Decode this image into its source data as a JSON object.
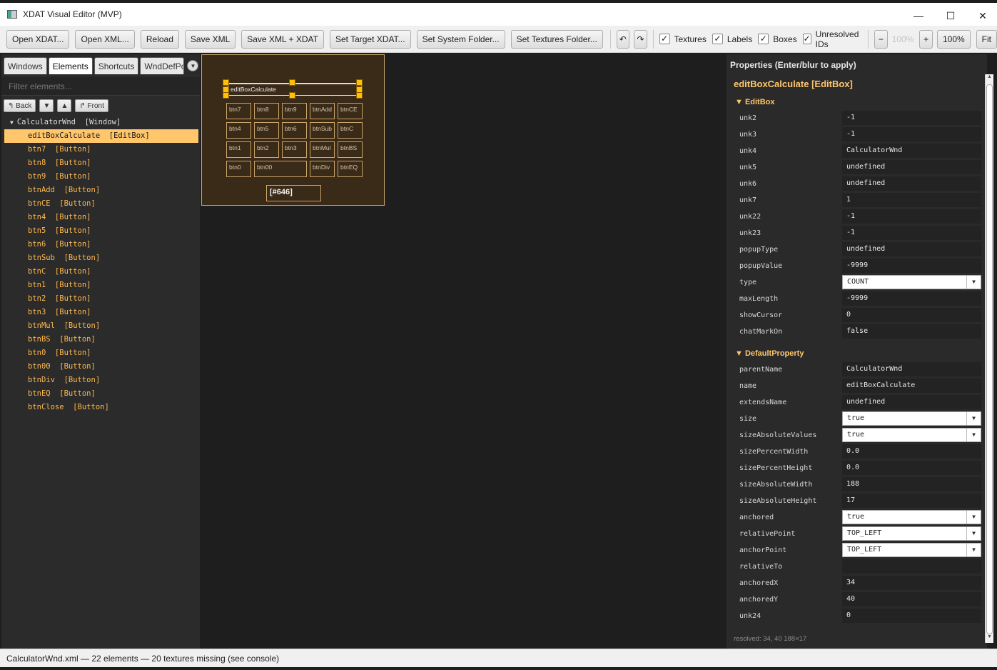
{
  "window": {
    "title": "XDAT Visual Editor (MVP)",
    "controls": {
      "minimize": "—",
      "maximize": "☐",
      "close": "✕"
    }
  },
  "toolbar": {
    "open_xdat": "Open XDAT...",
    "open_xml": "Open XML...",
    "reload": "Reload",
    "save_xml": "Save XML",
    "save_xml_xdat": "Save XML + XDAT",
    "set_target": "Set Target XDAT...",
    "set_system": "Set System Folder...",
    "set_textures": "Set Textures Folder...",
    "undo": "↶",
    "redo": "↷",
    "checkboxes": {
      "textures": "Textures",
      "labels": "Labels",
      "boxes": "Boxes",
      "unresolved": "Unresolved IDs"
    },
    "check_mark": "✓",
    "zoom_out": "−",
    "zoom_value": "100%",
    "zoom_in": "+",
    "zoom_reset": "100%",
    "fit": "Fit"
  },
  "left": {
    "tabs": [
      "Windows",
      "Elements",
      "Shortcuts",
      "WndDefPos"
    ],
    "tab_more": "▼",
    "filter_placeholder": "Filter elements...",
    "back": "↰ Back",
    "down": "▼",
    "up": "▲",
    "front": "↱ Front",
    "root": "CalculatorWnd  [Window]",
    "items": [
      "editBoxCalculate  [EditBox]",
      "btn7  [Button]",
      "btn8  [Button]",
      "btn9  [Button]",
      "btnAdd  [Button]",
      "btnCE  [Button]",
      "btn4  [Button]",
      "btn5  [Button]",
      "btn6  [Button]",
      "btnSub  [Button]",
      "btnC  [Button]",
      "btn1  [Button]",
      "btn2  [Button]",
      "btn3  [Button]",
      "btnMul  [Button]",
      "btnBS  [Button]",
      "btn0  [Button]",
      "btn00  [Button]",
      "btnDiv  [Button]",
      "btnEQ  [Button]",
      "btnClose  [Button]"
    ]
  },
  "canvas": {
    "editbox_label": "editBoxCalculate",
    "buttons": [
      "btn7",
      "btn8",
      "btn9",
      "btnAdd",
      "btnCE",
      "btn4",
      "btn5",
      "btn6",
      "btnSub",
      "btnC",
      "btn1",
      "btn2",
      "btn3",
      "btnMul",
      "btnBS",
      "btn0",
      "btn00",
      "btnDiv",
      "btnEQ"
    ],
    "number_field": "[#646]"
  },
  "props": {
    "title": "Properties (Enter/blur to apply)",
    "header": "editBoxCalculate [EditBox]",
    "section1": "▼ EditBox",
    "section2": "▼ DefaultProperty",
    "editbox_rows": [
      {
        "k": "unk2",
        "v": "-1"
      },
      {
        "k": "unk3",
        "v": "-1"
      },
      {
        "k": "unk4",
        "v": "CalculatorWnd"
      },
      {
        "k": "unk5",
        "v": "undefined"
      },
      {
        "k": "unk6",
        "v": "undefined"
      },
      {
        "k": "unk7",
        "v": "1"
      },
      {
        "k": "unk22",
        "v": "-1"
      },
      {
        "k": "unk23",
        "v": "-1"
      },
      {
        "k": "popupType",
        "v": "undefined"
      },
      {
        "k": "popupValue",
        "v": "-9999"
      },
      {
        "k": "type",
        "v": "COUNT",
        "select": true
      },
      {
        "k": "maxLength",
        "v": "-9999"
      },
      {
        "k": "showCursor",
        "v": "0"
      },
      {
        "k": "chatMarkOn",
        "v": "false"
      }
    ],
    "default_rows": [
      {
        "k": "parentName",
        "v": "CalculatorWnd"
      },
      {
        "k": "name",
        "v": "editBoxCalculate"
      },
      {
        "k": "extendsName",
        "v": "undefined"
      },
      {
        "k": "size",
        "v": "true",
        "select": true
      },
      {
        "k": "sizeAbsoluteValues",
        "v": "true",
        "select": true
      },
      {
        "k": "sizePercentWidth",
        "v": "0.0"
      },
      {
        "k": "sizePercentHeight",
        "v": "0.0"
      },
      {
        "k": "sizeAbsoluteWidth",
        "v": "188"
      },
      {
        "k": "sizeAbsoluteHeight",
        "v": "17"
      },
      {
        "k": "anchored",
        "v": "true",
        "select": true
      },
      {
        "k": "relativePoint",
        "v": "TOP_LEFT",
        "select": true
      },
      {
        "k": "anchorPoint",
        "v": "TOP_LEFT",
        "select": true
      },
      {
        "k": "relativeTo",
        "v": ""
      },
      {
        "k": "anchoredX",
        "v": "34"
      },
      {
        "k": "anchoredY",
        "v": "40"
      },
      {
        "k": "unk24",
        "v": "0"
      }
    ],
    "dropdown_arrow": "▼",
    "resolved": "resolved: 34, 40  188×17"
  },
  "status": {
    "text": "CalculatorWnd.xml — 22 elements — 20 textures missing (see console)"
  },
  "colors": {
    "accent": "#ffc66b",
    "tree_text": "#ffb84d",
    "handle": "#ffc107",
    "frame": "#c9a46b"
  }
}
